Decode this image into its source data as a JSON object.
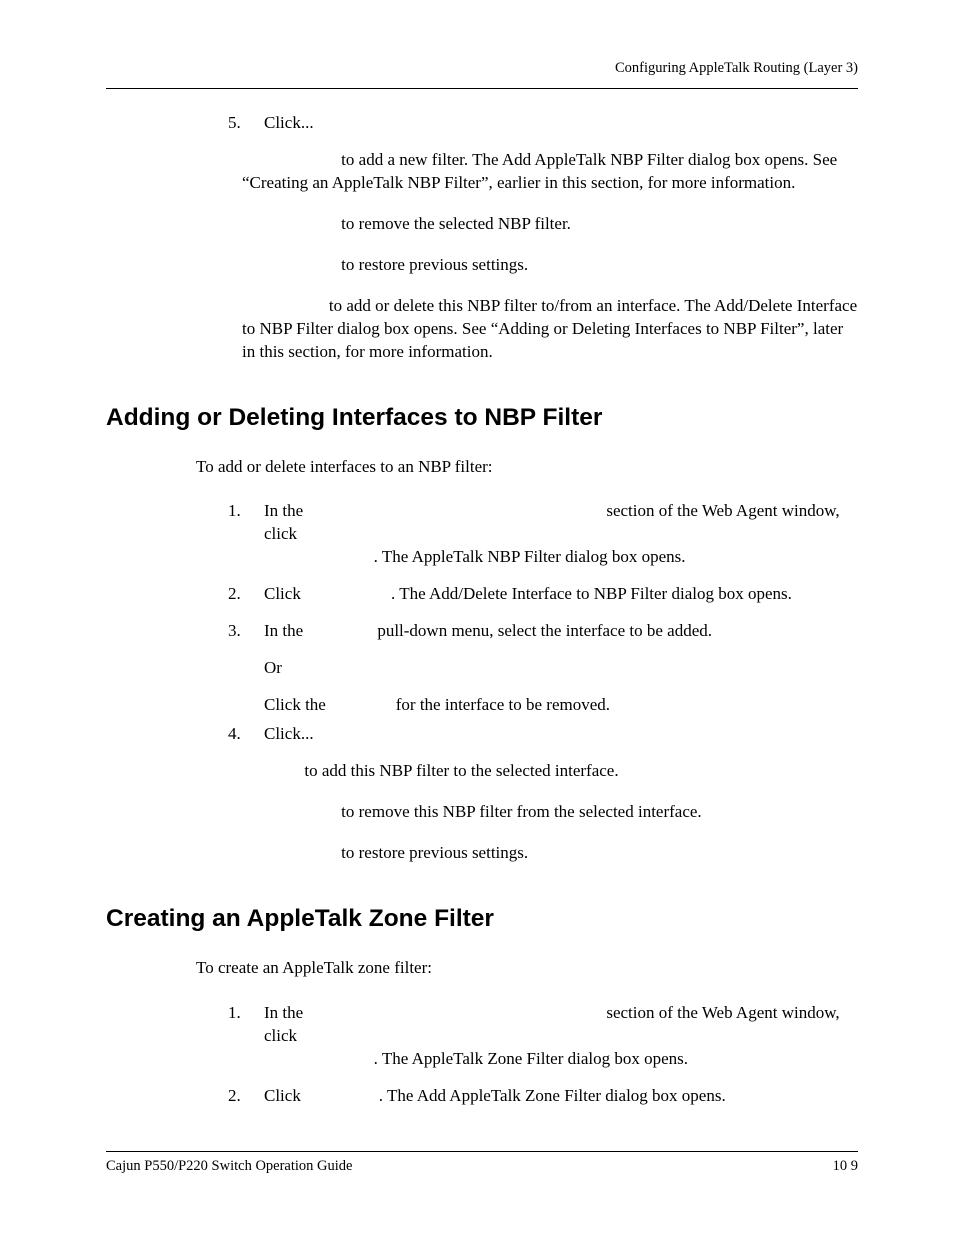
{
  "header": {
    "running": "Configuring AppleTalk Routing (Layer 3)"
  },
  "footer": {
    "left": "Cajun P550/P220 Switch Operation Guide",
    "right": "10 9"
  },
  "sec0": {
    "label": "Click...",
    "i1_text": " to add a new filter. The Add AppleTalk NBP Filter dialog box opens. See “Creating an AppleTalk NBP Filter”, earlier in this section, for more information.",
    "i2_text": " to remove the selected NBP filter.",
    "i3_text": " to restore previous settings.",
    "i4_text": " to add or delete this NBP filter to/from an interface. The Add/Delete Interface to NBP Filter dialog box opens. See “Adding or Deleting Interfaces to NBP Filter”, later in this section, for more information."
  },
  "sec1": {
    "heading": "Adding or Deleting Interfaces to NBP Filter",
    "intro": "To add or delete interfaces to an NBP filter:",
    "s1_a": "In the ",
    "s1_b": " section of the Web Agent window, click ",
    "s1_c": ". The AppleTalk NBP Filter dialog box opens.",
    "s2_a": "Click ",
    "s2_b": ". The Add/Delete Interface to NBP Filter dialog box opens.",
    "s3_a": "In the ",
    "s3_b": " pull-down menu, select the interface to be added.",
    "s3_or": "Or",
    "s3_c1": "Click the ",
    "s3_c2": " for the interface to be removed.",
    "s4_label": "Click...",
    "s4_i1": " to add this NBP filter to the selected interface.",
    "s4_i2": " to remove this NBP filter from the selected interface.",
    "s4_i3": " to restore previous settings."
  },
  "sec2": {
    "heading": "Creating an AppleTalk Zone Filter",
    "intro": "To create an AppleTalk zone filter:",
    "s1_a": "In the ",
    "s1_b": " section of the Web Agent window, click ",
    "s1_c": ". The AppleTalk Zone Filter dialog box opens.",
    "s2_a": "Click ",
    "s2_b": ". The Add AppleTalk Zone Filter dialog box opens."
  }
}
